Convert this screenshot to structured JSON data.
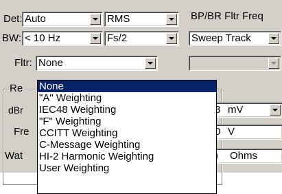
{
  "row1": {
    "det_label": "Det:",
    "det_value": "Auto",
    "rms_value": "RMS",
    "bp_label": "BP/BR Fltr Freq"
  },
  "row2": {
    "bw_label": "BW:",
    "bw_value": "< 10 Hz",
    "fs_value": "Fs/2",
    "sweep_value": "Sweep Track"
  },
  "row3": {
    "fltr_label": "Fltr:",
    "fltr_value": "None"
  },
  "group": {
    "title": "Re",
    "dbr_label": "dBr",
    "freq_label": "Fre",
    "watt_label": "Wat",
    "dbr_unit": "mV",
    "dbr_val_fragment": "3",
    "freq_val_fragment": "0",
    "freq_unit": "V",
    "watt_val_fragment": ")",
    "watt_unit": "Ohms"
  },
  "dropdown": {
    "items": [
      "None",
      "\"A\" Weighting",
      "IEC48 Weighting",
      "\"F\" Weighting",
      "CCITT Weighting",
      "C-Message Weighting",
      "HI-2 Harmonic Weighting",
      "User Weighting"
    ],
    "selected_index": 0
  },
  "icons": {
    "combo_arrow": "chevron-down-icon"
  },
  "colors": {
    "face": "#d4d0c8",
    "highlight": "#0a246a",
    "field": "#ffffff"
  }
}
